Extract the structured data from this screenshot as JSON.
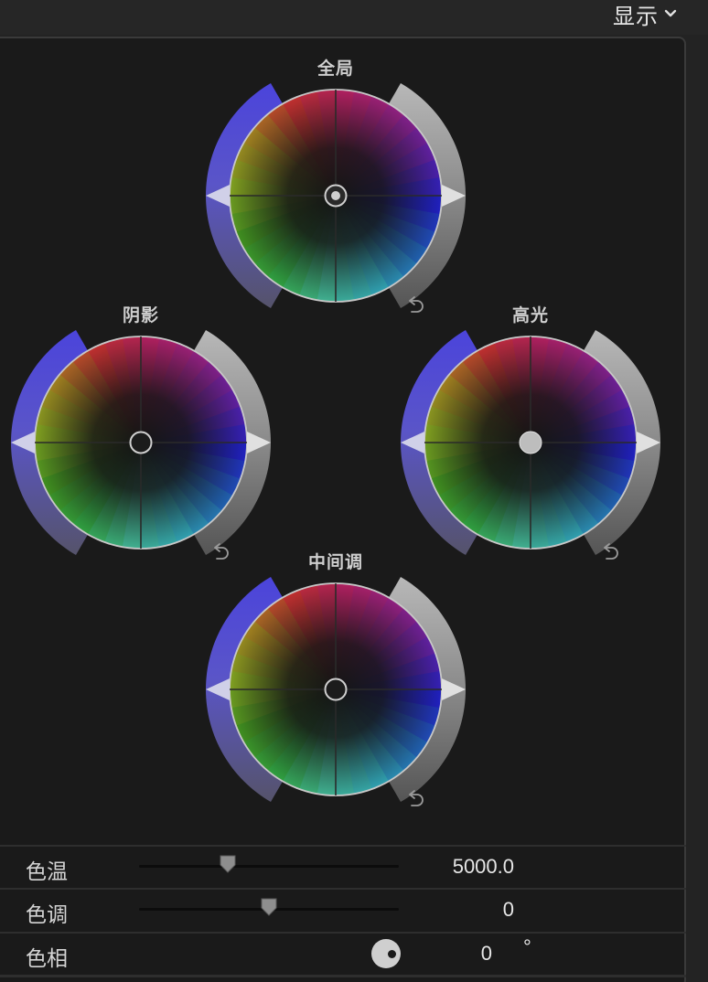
{
  "header": {
    "display_label": "显示"
  },
  "wheels": {
    "global": {
      "title": "全局"
    },
    "shadows": {
      "title": "阴影"
    },
    "highlights": {
      "title": "高光"
    },
    "midtones": {
      "title": "中间调"
    }
  },
  "sliders": {
    "temperature": {
      "label": "色温",
      "value": "5000.0",
      "position": 0.34
    },
    "tint": {
      "label": "色调",
      "value": "0",
      "position": 0.5
    },
    "hue": {
      "label": "色相",
      "value": "0",
      "unit": "°"
    }
  },
  "colors": {
    "background": "#1a1a1a",
    "panel_border": "#3a3a3a",
    "saturation_side": "#4a43d6",
    "brightness_side": "#9a9a9a"
  }
}
